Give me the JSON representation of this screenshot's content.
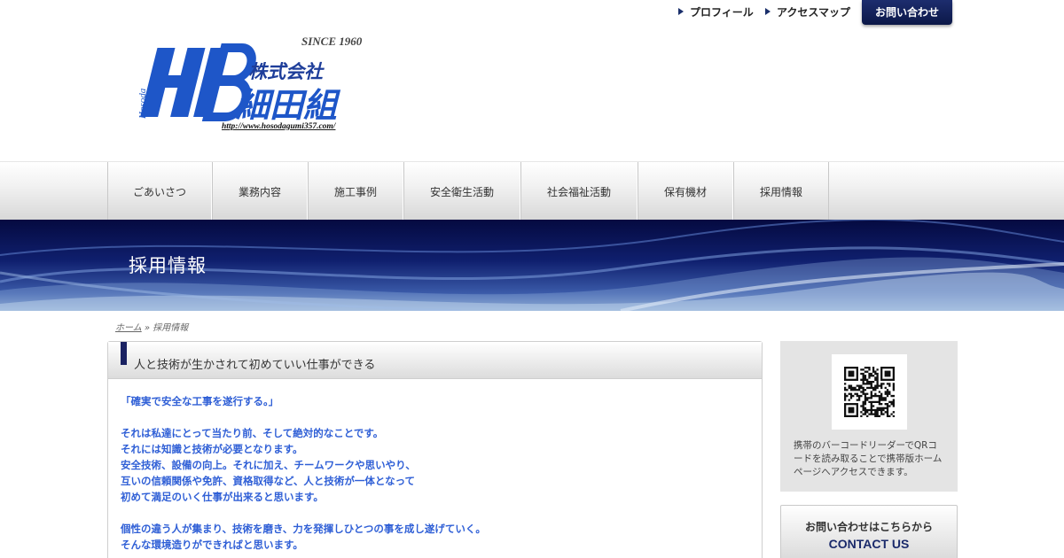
{
  "top_links": {
    "profile": "プロフィール",
    "access_map": "アクセスマップ",
    "contact": "お問い合わせ"
  },
  "logo": {
    "since": "SINCE 1960",
    "mark": "HB",
    "vertical_text": "Hosoda",
    "company_kabushiki": "株式会社",
    "company_name": "細田組",
    "url": "http://www.hosodagumi357.com/",
    "brand_color": "#1e56c8"
  },
  "nav": {
    "items": [
      {
        "label": "ごあいさつ"
      },
      {
        "label": "業務内容"
      },
      {
        "label": "施工事例"
      },
      {
        "label": "安全衛生活動"
      },
      {
        "label": "社会福祉活動"
      },
      {
        "label": "保有機材"
      },
      {
        "label": "採用情報"
      }
    ]
  },
  "hero": {
    "title": "採用情報"
  },
  "breadcrumb": {
    "home": "ホーム",
    "separator": "»",
    "current": "採用情報"
  },
  "main": {
    "heading": "人と技術が生かされて初めていい仕事ができる",
    "paragraphs": [
      [
        "「確実で安全な工事を遂行する。」"
      ],
      [
        "それは私達にとって当たり前、そして絶対的なことです。",
        "それには知識と技術が必要となります。",
        "安全技術、設備の向上。それに加え、チームワークや思いやり、",
        "互いの信頼関係や免許、資格取得など、人と技術が一体となって",
        "初めて満足のいく仕事が出来ると思います。"
      ],
      [
        "個性の違う人が集まり、技術を磨き、力を発揮しひとつの事を成し遂げていく。",
        "そんな環境造りができればと思います。"
      ]
    ],
    "text_color": "#2f5fd6"
  },
  "sidebar": {
    "qr_description": "携帯のバーコードリーダーでQRコードを読み取ることで携帯版ホームページへアクセスできます。",
    "contact_jp": "お問い合わせはこちらから",
    "contact_en": "CONTACT US"
  },
  "colors": {
    "navy": "#1a2262",
    "hero_dark": "#050a40",
    "link_blue": "#2f5fd6"
  }
}
